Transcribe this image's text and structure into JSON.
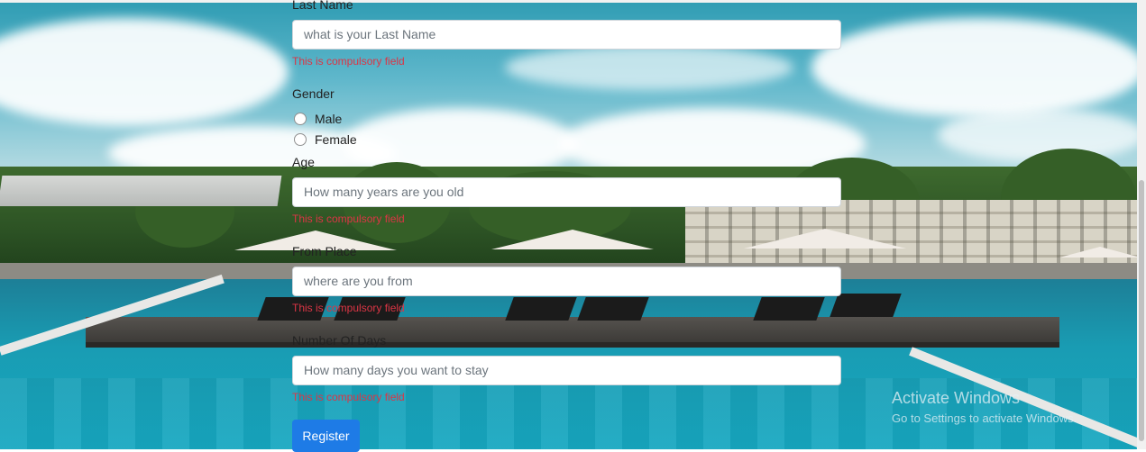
{
  "form": {
    "last_name": {
      "label": "Last Name",
      "placeholder": "what is your Last Name",
      "error": "This is compulsory field"
    },
    "gender": {
      "label": "Gender",
      "options": [
        "Male",
        "Female"
      ]
    },
    "age": {
      "label": "Age",
      "placeholder": "How many years are you old",
      "error": "This is compulsory field"
    },
    "from_place": {
      "label": "From Place",
      "placeholder": "where are you from",
      "error": "This is compulsory field"
    },
    "number_of_days": {
      "label": "Number Of Days",
      "placeholder": "How many days you want to stay",
      "error": "This is compulsory field"
    },
    "submit_label": "Register"
  },
  "watermark": {
    "title": "Activate Windows",
    "subtitle": "Go to Settings to activate Windows."
  },
  "colors": {
    "error": "#dc3545",
    "button": "#1e7be6"
  }
}
